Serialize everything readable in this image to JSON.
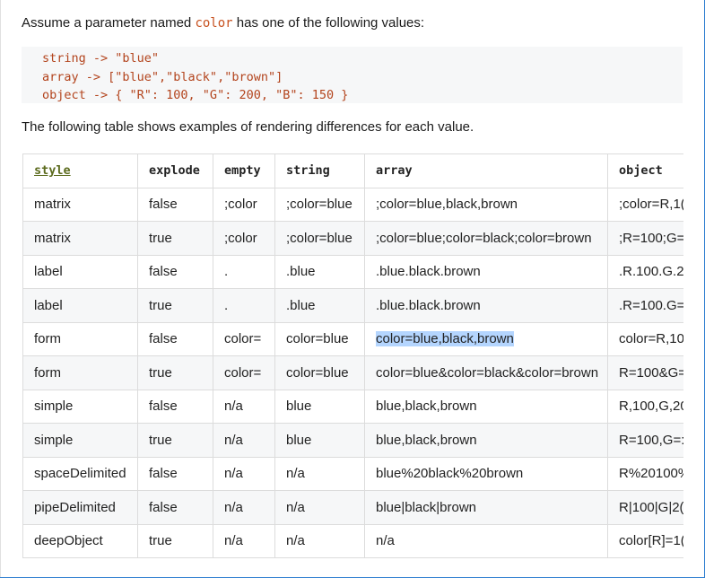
{
  "intro": {
    "prefix": "Assume a parameter named",
    "param": "color",
    "suffix": "has one of the following values:"
  },
  "code_lines": [
    "string -> \"blue\"",
    "array -> [\"blue\",\"black\",\"brown\"]",
    "object -> { \"R\": 100, \"G\": 200, \"B\": 150 }"
  ],
  "description": "The following table shows examples of rendering differences for each value.",
  "table": {
    "headers": [
      "style",
      "explode",
      "empty",
      "string",
      "array",
      "object"
    ],
    "rows": [
      [
        "matrix",
        "false",
        ";color",
        ";color=blue",
        ";color=blue,black,brown",
        ";color=R,1("
      ],
      [
        "matrix",
        "true",
        ";color",
        ";color=blue",
        ";color=blue;color=black;color=brown",
        ";R=100;G="
      ],
      [
        "label",
        "false",
        ".",
        ".blue",
        ".blue.black.brown",
        ".R.100.G.2"
      ],
      [
        "label",
        "true",
        ".",
        ".blue",
        ".blue.black.brown",
        ".R=100.G="
      ],
      [
        "form",
        "false",
        "color=",
        "color=blue",
        "color=blue,black,brown",
        "color=R,10"
      ],
      [
        "form",
        "true",
        "color=",
        "color=blue",
        "color=blue&color=black&color=brown",
        "R=100&G="
      ],
      [
        "simple",
        "false",
        "n/a",
        "blue",
        "blue,black,brown",
        "R,100,G,20"
      ],
      [
        "simple",
        "true",
        "n/a",
        "blue",
        "blue,black,brown",
        "R=100,G=:"
      ],
      [
        "spaceDelimited",
        "false",
        "n/a",
        "n/a",
        "blue%20black%20brown",
        "R%20100%"
      ],
      [
        "pipeDelimited",
        "false",
        "n/a",
        "n/a",
        "blue|black|brown",
        "R|100|G|2("
      ],
      [
        "deepObject",
        "true",
        "n/a",
        "n/a",
        "n/a",
        "color[R]=1("
      ]
    ]
  },
  "highlight": {
    "row": 4,
    "col": 4,
    "color": "#b4d5fe"
  }
}
